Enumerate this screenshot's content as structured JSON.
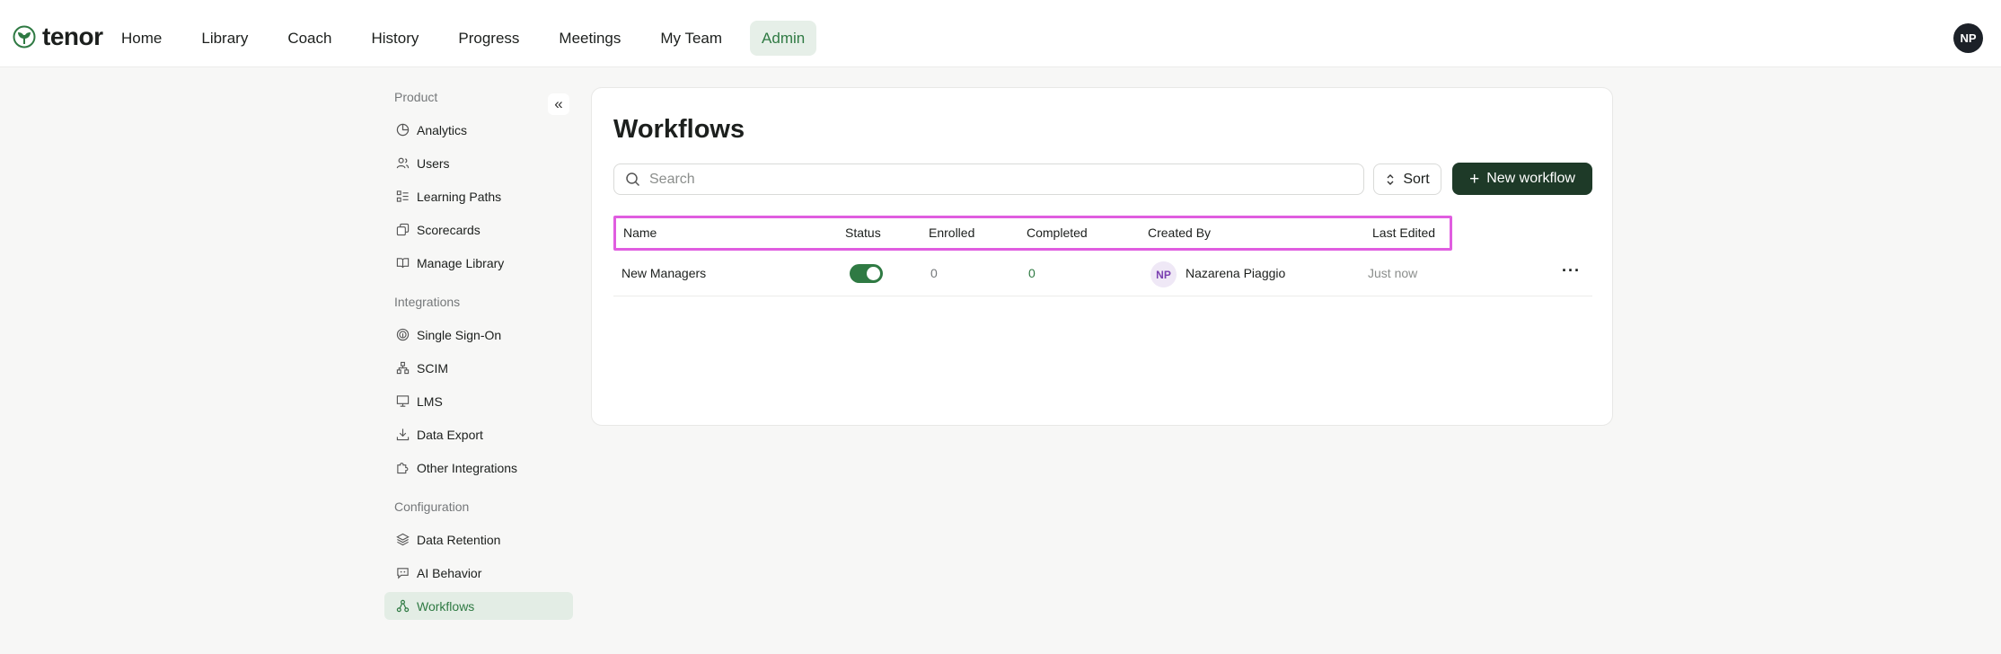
{
  "app": {
    "logo_text": "tenor"
  },
  "nav": {
    "items": [
      {
        "label": "Home"
      },
      {
        "label": "Library"
      },
      {
        "label": "Coach"
      },
      {
        "label": "History"
      },
      {
        "label": "Progress"
      },
      {
        "label": "Meetings"
      },
      {
        "label": "My Team"
      },
      {
        "label": "Admin",
        "active": true
      }
    ],
    "user_initials": "NP"
  },
  "sidebar": {
    "sections": [
      {
        "title": "Product",
        "items": [
          {
            "label": "Analytics",
            "icon": "pie-chart-icon"
          },
          {
            "label": "Users",
            "icon": "users-icon"
          },
          {
            "label": "Learning Paths",
            "icon": "list-checks-icon"
          },
          {
            "label": "Scorecards",
            "icon": "scorecard-icon"
          },
          {
            "label": "Manage Library",
            "icon": "book-open-icon"
          }
        ]
      },
      {
        "title": "Integrations",
        "items": [
          {
            "label": "Single Sign-On",
            "icon": "fingerprint-icon"
          },
          {
            "label": "SCIM",
            "icon": "network-icon"
          },
          {
            "label": "LMS",
            "icon": "presentation-icon"
          },
          {
            "label": "Data Export",
            "icon": "download-icon"
          },
          {
            "label": "Other Integrations",
            "icon": "puzzle-icon"
          }
        ]
      },
      {
        "title": "Configuration",
        "items": [
          {
            "label": "Data Retention",
            "icon": "layers-icon"
          },
          {
            "label": "AI Behavior",
            "icon": "bot-message-icon"
          },
          {
            "label": "Workflows",
            "icon": "workflow-icon",
            "active": true
          }
        ]
      }
    ]
  },
  "main": {
    "title": "Workflows",
    "search_placeholder": "Search",
    "sort_label": "Sort",
    "new_button_label": "New workflow",
    "columns": [
      "Name",
      "Status",
      "Enrolled",
      "Completed",
      "Created By",
      "Last Edited"
    ],
    "rows": [
      {
        "name": "New Managers",
        "status": "on",
        "enrolled": "0",
        "completed": "0",
        "creator_initials": "NP",
        "creator_name": "Nazarena Piaggio",
        "last_edited": "Just now"
      }
    ]
  },
  "colors": {
    "accent": "#2f7a43",
    "primary_button": "#1e3a28",
    "highlight_box": "#e05de0"
  }
}
